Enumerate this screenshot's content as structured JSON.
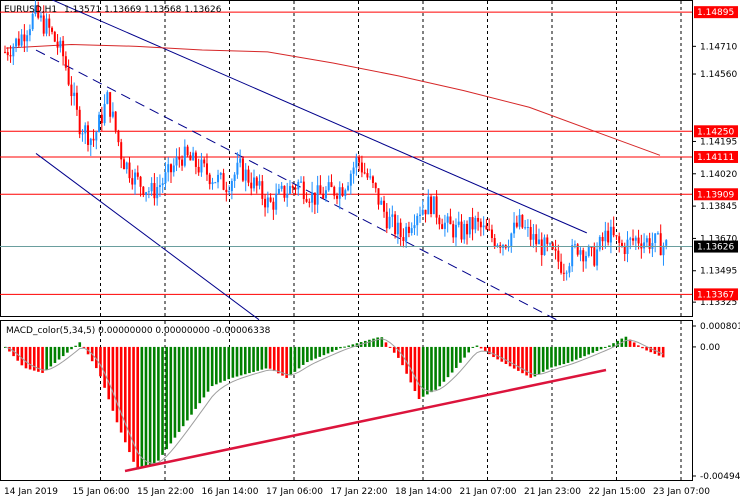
{
  "header": {
    "symbol_label": "EURUSD,H1",
    "ohlc": "1.13571 1.13669 1.13568 1.13626"
  },
  "macd_header": "MACD_color(5,34,5) 0.00000000 0.00000000 -0.00006338",
  "price_scale": {
    "labels": [
      "1.14710",
      "1.14560",
      "1.14195",
      "1.14020",
      "1.13845",
      "1.13670",
      "1.13495",
      "1.13325"
    ],
    "highlight_levels": [
      "1.14895",
      "1.14250",
      "1.14111",
      "1.13909",
      "1.13367"
    ],
    "current_price": "1.13626"
  },
  "macd_scale": {
    "top": "0.0008011",
    "zero": "0.00",
    "bottom": "-0.004943"
  },
  "time_axis": [
    "14 Jan 2019",
    "15 Jan 06:00",
    "15 Jan 22:00",
    "16 Jan 14:00",
    "17 Jan 06:00",
    "17 Jan 22:00",
    "18 Jan 14:00",
    "21 Jan 07:00",
    "21 Jan 23:00",
    "22 Jan 15:00",
    "23 Jan 07:00"
  ],
  "colors": {
    "bull": "#1e90ff",
    "bear": "#ff0000",
    "level_line": "#ff0000",
    "channel": "#00008b",
    "ma": "#d62728",
    "macd_up": "#008000",
    "macd_down": "#ff0000",
    "signal": "#9e9e9e",
    "current_line": "#6a9e9e",
    "divergence": "#dc143c"
  },
  "chart_data": {
    "type": "candlestick",
    "symbol": "EURUSD",
    "timeframe": "H1",
    "ylim": [
      1.1325,
      1.1495
    ],
    "levels": [
      1.14895,
      1.1425,
      1.14111,
      1.13909,
      1.13367
    ],
    "current_price": 1.13626,
    "x_range": [
      "14 Jan 2019",
      "23 Jan 07:00"
    ],
    "price_path": [
      1.1468,
      1.1475,
      1.1488,
      1.148,
      1.1465,
      1.143,
      1.142,
      1.1443,
      1.141,
      1.1398,
      1.1392,
      1.14,
      1.1412,
      1.1407,
      1.1401,
      1.1396,
      1.1405,
      1.1396,
      1.1385,
      1.1392,
      1.1397,
      1.1389,
      1.1392,
      1.1395,
      1.141,
      1.1395,
      1.1378,
      1.1368,
      1.1382,
      1.1386,
      1.1374,
      1.137,
      1.1375,
      1.1368,
      1.1365,
      1.1375,
      1.1366,
      1.136,
      1.1352,
      1.1363,
      1.1356,
      1.137,
      1.1362,
      1.1367,
      1.1365,
      1.1363
    ],
    "ma_path": [
      1.147,
      1.1472,
      1.1471,
      1.1469,
      1.1468,
      1.1462,
      1.1455,
      1.1447,
      1.1438,
      1.1425,
      1.1412
    ],
    "channel": {
      "upper": [
        [
          "14 Jan 2019",
          1.15
        ],
        [
          "22 Jan 00:00",
          1.137
        ]
      ],
      "middle": [
        [
          "14 Jan 2019",
          1.1469
        ],
        [
          "21 Jan 14:00",
          1.1323
        ]
      ],
      "lower": [
        [
          "14 Jan 2019",
          1.1413
        ],
        [
          "17 Jan 12:00",
          1.1323
        ]
      ]
    },
    "macd": {
      "ylim": [
        -0.004943,
        0.0008011
      ],
      "path": [
        0.0,
        -0.0008,
        -0.001,
        -0.0004,
        0.0002,
        -0.001,
        -0.003,
        -0.0047,
        -0.0045,
        -0.0035,
        -0.0025,
        -0.0015,
        -0.0012,
        -0.001,
        -0.0008,
        -0.0012,
        -0.0006,
        -0.0003,
        0.0,
        0.0002,
        0.0004,
        -0.0005,
        -0.002,
        -0.0016,
        -0.0008,
        0.0001,
        -0.0004,
        -0.0008,
        -0.0012,
        -0.0008,
        -0.0006,
        -0.0003,
        0.0,
        0.0004,
        -0.0001,
        -0.0004
      ]
    }
  }
}
